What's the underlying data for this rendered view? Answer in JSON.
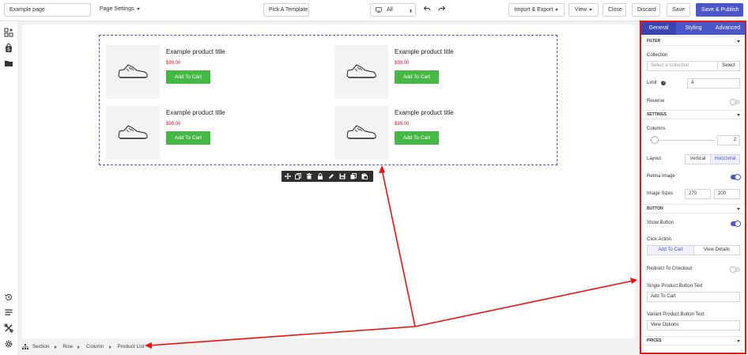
{
  "topbar": {
    "page_name": "Example page",
    "page_settings": "Page Settings",
    "pick_template": "Pick A Template",
    "device_value": "All",
    "import_export": "Import & Export",
    "view": "View",
    "close": "Close",
    "discard": "Discard",
    "save": "Save",
    "save_publish": "Save & Publish"
  },
  "products": [
    {
      "title": "Example product title",
      "price": "$99.00",
      "button": "Add To Cart"
    },
    {
      "title": "Example product title",
      "price": "$99.00",
      "button": "Add To Cart"
    },
    {
      "title": "Example product title",
      "price": "$99.00",
      "button": "Add To Cart"
    },
    {
      "title": "Example product title",
      "price": "$99.00",
      "button": "Add To Cart"
    }
  ],
  "breadcrumb": [
    "Section",
    "Row",
    "Column",
    "Product List"
  ],
  "sidebar": {
    "tabs": [
      "General",
      "Styling",
      "Advanced"
    ],
    "filter": {
      "header": "FILTER",
      "collection_label": "Collection",
      "collection_placeholder": "Select a collection",
      "select_button": "Select",
      "limit_label": "Limit",
      "limit_value": "4",
      "reverse_label": "Reverse"
    },
    "settings": {
      "header": "SETTINGS",
      "columns_label": "Columns",
      "columns_value": "2",
      "layout_label": "Layout",
      "layout_options": [
        "Vertical",
        "Horizontal"
      ],
      "layout_selected": "Horizontal",
      "retina_label": "Retina Image",
      "image_sizes_label": "Image Sizes",
      "image_width": "270",
      "image_height": "200"
    },
    "button": {
      "header": "BUTTON",
      "show_button_label": "Show Button",
      "click_action_label": "Click Action",
      "click_options": [
        "Add To Cart",
        "View Details"
      ],
      "click_selected": "Add To Cart",
      "redirect_label": "Redirect To Checkout",
      "single_text_label": "Single Product Button Text",
      "single_text_value": "Add To Cart",
      "variant_text_label": "Variant Product Button Text",
      "variant_text_value": "View Options"
    },
    "prices": {
      "header": "PRICES"
    }
  },
  "toggles": {
    "reverse": false,
    "retina_image": true,
    "show_button": true,
    "redirect_to_checkout": false
  },
  "colors": {
    "accent": "#4b56c9",
    "cart_button": "#46b846",
    "price": "#d0112b",
    "annotation": "#e11111"
  }
}
